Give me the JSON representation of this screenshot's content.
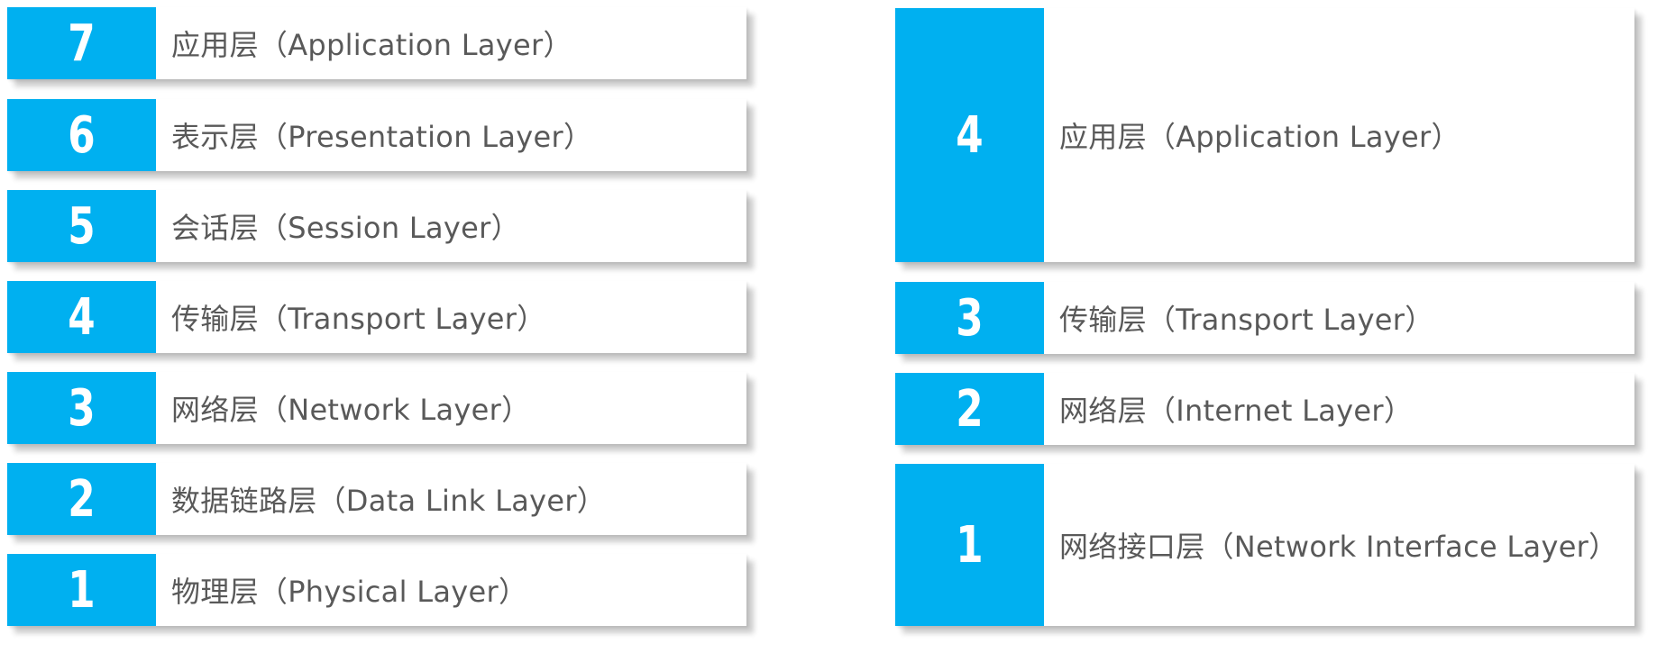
{
  "osi": {
    "layers": [
      {
        "number": "7",
        "label": "应用层（Application Layer）"
      },
      {
        "number": "6",
        "label": "表示层（Presentation Layer）"
      },
      {
        "number": "5",
        "label": "会话层（Session Layer）"
      },
      {
        "number": "4",
        "label": "传输层（Transport Layer）"
      },
      {
        "number": "3",
        "label": "网络层（Network Layer）"
      },
      {
        "number": "2",
        "label": "数据链路层（Data Link Layer）"
      },
      {
        "number": "1",
        "label": "物理层（Physical Layer）"
      }
    ]
  },
  "tcpip": {
    "layers": [
      {
        "number": "4",
        "label": "应用层（Application Layer）"
      },
      {
        "number": "3",
        "label": "传输层（Transport Layer）"
      },
      {
        "number": "2",
        "label": "网络层（Internet Layer）"
      },
      {
        "number": "1",
        "label": "网络接口层（Network Interface Layer）"
      }
    ]
  },
  "colors": {
    "accent": "#00b0f0",
    "text": "#595959",
    "number_text": "#ffffff"
  }
}
